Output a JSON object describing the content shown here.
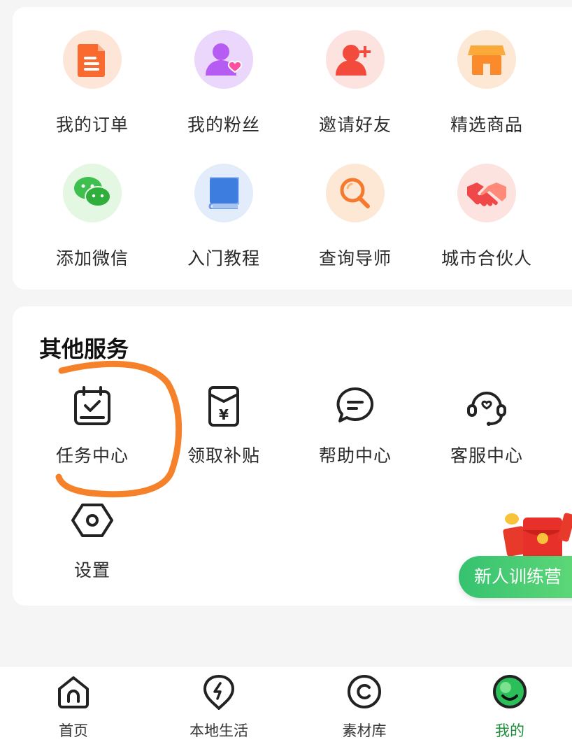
{
  "quick_menu": [
    {
      "label": "我的订单",
      "icon": "order-doc-icon",
      "color": "#fa6a2e"
    },
    {
      "label": "我的粉丝",
      "icon": "fans-user-heart-icon",
      "color": "#b65cf2"
    },
    {
      "label": "邀请好友",
      "icon": "invite-user-plus-icon",
      "color": "#f24a3c"
    },
    {
      "label": "精选商品",
      "icon": "store-icon",
      "color": "#fb8a2a"
    },
    {
      "label": "添加微信",
      "icon": "wechat-icon",
      "color": "#3fbf4d"
    },
    {
      "label": "入门教程",
      "icon": "book-icon",
      "color": "#3e7de0"
    },
    {
      "label": "查询导师",
      "icon": "search-icon",
      "color": "#f57a2e"
    },
    {
      "label": "城市合伙人",
      "icon": "handshake-icon",
      "color": "#f04848"
    }
  ],
  "other_services": {
    "title": "其他服务",
    "items": [
      {
        "label": "任务中心",
        "icon": "task-calendar-check-icon"
      },
      {
        "label": "领取补贴",
        "icon": "subsidy-envelope-yen-icon"
      },
      {
        "label": "帮助中心",
        "icon": "help-chat-bubble-icon"
      },
      {
        "label": "客服中心",
        "icon": "customer-service-headset-icon"
      },
      {
        "label": "设置",
        "icon": "settings-hexagon-icon"
      }
    ]
  },
  "promo": {
    "label": "新人训练营"
  },
  "tabbar": [
    {
      "label": "首页",
      "icon": "home-icon",
      "active": false
    },
    {
      "label": "本地生活",
      "icon": "local-life-bolt-icon",
      "active": false
    },
    {
      "label": "素材库",
      "icon": "material-library-icon",
      "active": false
    },
    {
      "label": "我的",
      "icon": "profile-avatar-icon",
      "active": true
    }
  ],
  "annotation_color": "#f5822b",
  "accent_green": "#1f8f3e"
}
